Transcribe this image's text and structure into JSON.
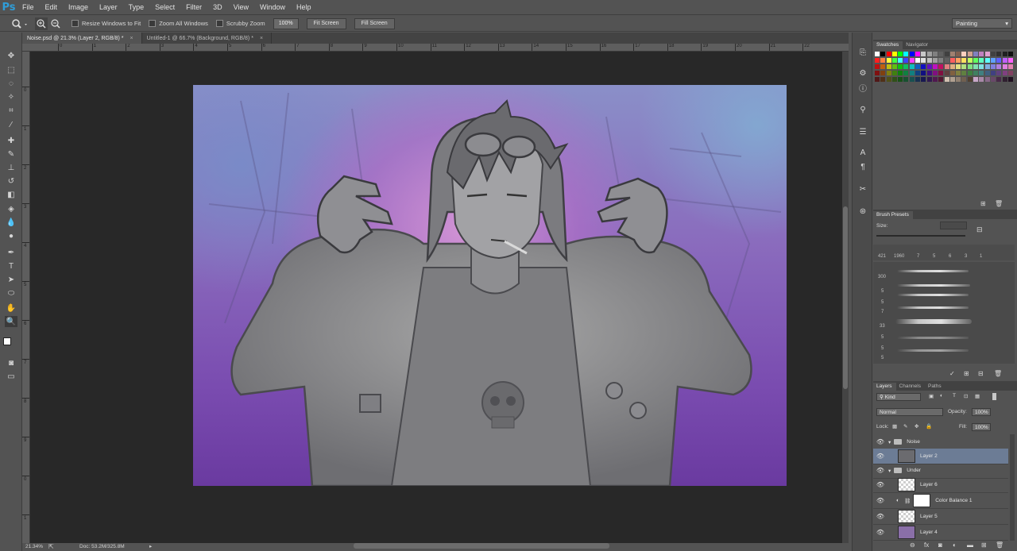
{
  "app": {
    "logo": "Ps"
  },
  "menu": [
    "File",
    "Edit",
    "Image",
    "Layer",
    "Type",
    "Select",
    "Filter",
    "3D",
    "View",
    "Window",
    "Help"
  ],
  "options": {
    "resize_windows": "Resize Windows to Fit",
    "zoom_all": "Zoom All Windows",
    "scrubby": "Scrubby Zoom",
    "zoom_value": "100%",
    "fit_screen": "Fit Screen",
    "fill_screen": "Fill Screen",
    "workspace": "Painting"
  },
  "tabs": [
    {
      "label": "Noise.psd @ 21.3% (Layer 2, RGB/8) *",
      "close": "×"
    },
    {
      "label": "Untitled-1 @ 66.7% (Background, RGB/8) *",
      "close": "×"
    }
  ],
  "ruler_top": [
    "0",
    "1",
    "2",
    "3",
    "4",
    "5",
    "6",
    "7",
    "8",
    "9",
    "10",
    "11",
    "12",
    "13",
    "14",
    "15",
    "16",
    "17",
    "18",
    "19",
    "20",
    "21",
    "22"
  ],
  "ruler_left": [
    "0",
    "1",
    "2",
    "3",
    "4",
    "5",
    "6",
    "7",
    "8",
    "9",
    "0",
    "1",
    "2"
  ],
  "status": {
    "zoom": "21.34%",
    "doc": "Doc: 53.2M/325.8M"
  },
  "panels": {
    "swatches_tabs": [
      "Swatches",
      "Navigator"
    ],
    "brush_tabs": [
      "Brush Presets"
    ],
    "brush_size_label": "Size:",
    "brush_sizes_row": [
      "421",
      "1960",
      "7",
      "5",
      "6",
      "3",
      "1"
    ],
    "brush_sizes_col": [
      "300",
      "5",
      "5",
      "7",
      "33",
      "5",
      "5",
      "5"
    ],
    "layer_tabs": [
      "Layers",
      "Channels",
      "Paths"
    ],
    "kind": "Kind",
    "blend": "Normal",
    "opacity_label": "Opacity:",
    "opacity": "100%",
    "lock_label": "Lock:",
    "fill_label": "Fill:",
    "fill": "100%",
    "layers": [
      {
        "name": "Noise",
        "type": "group"
      },
      {
        "name": "Layer 2",
        "type": "layer",
        "selected": true
      },
      {
        "name": "Under",
        "type": "group"
      },
      {
        "name": "Layer 6",
        "type": "layer"
      },
      {
        "name": "Color Balance 1",
        "type": "adjustment"
      },
      {
        "name": "Layer 5",
        "type": "layer"
      },
      {
        "name": "Layer 4",
        "type": "layer"
      }
    ]
  },
  "colors": {
    "swatches": [
      "#ffffff",
      "#000000",
      "#ff0000",
      "#ffff00",
      "#00ff00",
      "#00ffff",
      "#0000ff",
      "#ff00ff",
      "#c8c8c8",
      "#a0a0a0",
      "#808080",
      "#606060",
      "#404040",
      "#a08070",
      "#806050",
      "#ffd0c0",
      "#d0a090",
      "#8080c0",
      "#c080c0",
      "#e0a0d0",
      "#404040",
      "#303030",
      "#202020",
      "#101010",
      "#ff2020",
      "#ff8040",
      "#ffff40",
      "#40ff40",
      "#40ffff",
      "#4040ff",
      "#ff40ff",
      "#ffffff",
      "#e0e0e0",
      "#c0c0c0",
      "#a0a0a0",
      "#808080",
      "#606060",
      "#ff6060",
      "#ffa060",
      "#ffe060",
      "#c0ff60",
      "#60ff60",
      "#60ffc0",
      "#60ffff",
      "#60a0ff",
      "#6060ff",
      "#c060ff",
      "#ff60ff",
      "#c01010",
      "#c06010",
      "#c0c010",
      "#60c010",
      "#10c010",
      "#10c060",
      "#10c0c0",
      "#1060c0",
      "#1010c0",
      "#6010c0",
      "#c010c0",
      "#c01060",
      "#e08080",
      "#e0b080",
      "#e0e080",
      "#b0e080",
      "#80e080",
      "#80e0b0",
      "#80e0e0",
      "#80b0e0",
      "#8080e0",
      "#b080e0",
      "#e080e0",
      "#e080b0",
      "#801010",
      "#804010",
      "#808010",
      "#408010",
      "#108010",
      "#108040",
      "#108080",
      "#104080",
      "#101080",
      "#401080",
      "#801080",
      "#801040",
      "#604040",
      "#806040",
      "#808040",
      "#608040",
      "#408040",
      "#408060",
      "#408080",
      "#406080",
      "#404080",
      "#604080",
      "#804080",
      "#804060",
      "#501818",
      "#503018",
      "#505018",
      "#305018",
      "#185018",
      "#185030",
      "#185050",
      "#183050",
      "#181850",
      "#301850",
      "#501850",
      "#501830",
      "#d0c0b0",
      "#b0a090",
      "#908070",
      "#706050",
      "#504030",
      "#c8a8c8",
      "#a888a8",
      "#886888",
      "#684868",
      "#482848",
      "#302030",
      "#201020"
    ]
  }
}
